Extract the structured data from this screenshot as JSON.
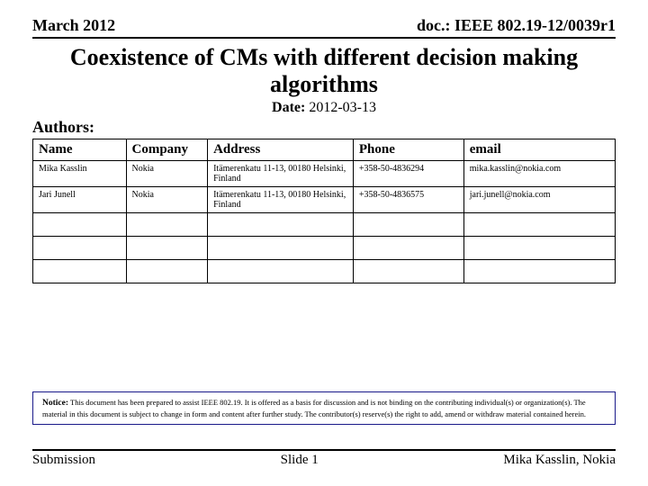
{
  "header": {
    "date_month": "March 2012",
    "doc_id": "doc.: IEEE 802.19-12/0039r1"
  },
  "title": "Coexistence of CMs with different decision making algorithms",
  "date": {
    "label": "Date:",
    "value": "2012-03-13"
  },
  "authors_label": "Authors:",
  "authors": {
    "headers": {
      "name": "Name",
      "company": "Company",
      "address": "Address",
      "phone": "Phone",
      "email": "email"
    },
    "rows": [
      {
        "name": "Mika Kasslin",
        "company": "Nokia",
        "address": "Itämerenkatu 11-13, 00180 Helsinki, Finland",
        "phone": "+358-50-4836294",
        "email": "mika.kasslin@nokia.com"
      },
      {
        "name": "Jari Junell",
        "company": "Nokia",
        "address": "Itämerenkatu 11-13, 00180 Helsinki, Finland",
        "phone": "+358-50-4836575",
        "email": "jari.junell@nokia.com"
      },
      {
        "name": "",
        "company": "",
        "address": "",
        "phone": "",
        "email": ""
      },
      {
        "name": "",
        "company": "",
        "address": "",
        "phone": "",
        "email": ""
      },
      {
        "name": "",
        "company": "",
        "address": "",
        "phone": "",
        "email": ""
      }
    ]
  },
  "notice": {
    "label": "Notice:",
    "text": "This document has been prepared to assist IEEE 802.19. It is offered as a basis for discussion and is not binding on the contributing individual(s) or organization(s). The material in this document is subject to change in form and content after further study. The contributor(s) reserve(s) the right to add, amend or withdraw material contained herein."
  },
  "footer": {
    "left": "Submission",
    "center": "Slide 1",
    "right": "Mika Kasslin, Nokia"
  }
}
